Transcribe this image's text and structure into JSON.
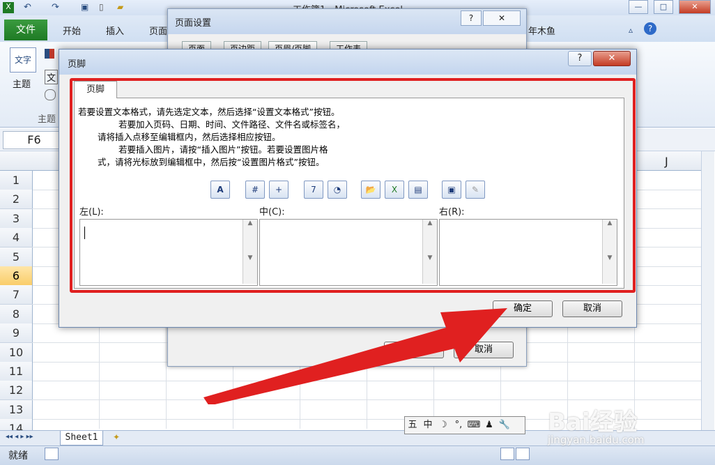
{
  "window": {
    "title": "工作簿1 - Microsoft Excel"
  },
  "ribbon": {
    "tabs": [
      "文件",
      "开始",
      "插入",
      "页面"
    ],
    "right_text": "年木鱼",
    "theme_label": "主题",
    "theme_group": "主题",
    "theme_icon_text": "文字",
    "small_text": "文"
  },
  "namebox": {
    "value": "F6"
  },
  "columns": {
    "visible_right": "J"
  },
  "rows": [
    "1",
    "2",
    "3",
    "4",
    "5",
    "6",
    "7",
    "8",
    "9",
    "10",
    "11",
    "12",
    "13",
    "14"
  ],
  "selected_row": "6",
  "sheet_tabs": {
    "sheet1": "Sheet1"
  },
  "status": {
    "ready": "就绪"
  },
  "page_setup": {
    "title": "页面设置",
    "tabs": [
      "页面",
      "页边距",
      "页眉/页脚",
      "工作表"
    ],
    "ok": "确定",
    "cancel": "取消",
    "help": "?",
    "close": "✕"
  },
  "footer_dialog": {
    "title": "页脚",
    "help": "?",
    "close": "✕",
    "tab": "页脚",
    "instructions": [
      "若要设置文本格式，请先选定文本，然后选择“设置文本格式”按钮。",
      "若要加入页码、日期、时间、文件路径、文件名或标签名，",
      "请将插入点移至编辑框内，然后选择相应按钮。",
      "若要插入图片，请按“插入图片”按钮。若要设置图片格",
      "式，请将光标放到编辑框中，然后按“设置图片格式”按钮。"
    ],
    "toolbar_icons": [
      "format-text-icon",
      "page-number-icon",
      "page-count-icon",
      "date-icon",
      "time-icon",
      "file-path-icon",
      "file-name-icon",
      "sheet-name-icon",
      "insert-picture-icon",
      "format-picture-icon"
    ],
    "toolbar_glyphs": [
      "A",
      "#",
      "+",
      "7",
      "◔",
      "📂",
      "X",
      "▤",
      "▣",
      "✎"
    ],
    "left_label": "左(L):",
    "center_label": "中(C):",
    "right_label": "右(R):",
    "ok": "确定",
    "cancel": "取消"
  },
  "ime_bar": {
    "items": [
      "五",
      "中",
      "☽",
      "°,",
      "⌨",
      "♟",
      "🔧"
    ]
  },
  "watermark": {
    "brand": "Bai经验",
    "url": "jingyan.baidu.com"
  },
  "colors": {
    "highlight": "#e02020",
    "excel_green": "#1e7a24",
    "arrow": "#e02020"
  }
}
